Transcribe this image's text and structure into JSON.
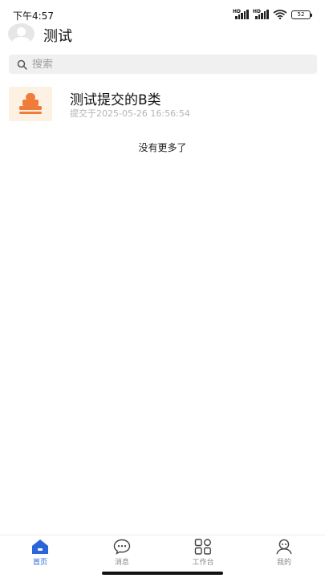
{
  "status_bar": {
    "time": "下午4:57",
    "signal1_label": "HD",
    "signal2_label": "HD",
    "battery": "52"
  },
  "header": {
    "title": "测试"
  },
  "search": {
    "placeholder": "搜索"
  },
  "list": {
    "items": [
      {
        "title": "测试提交的B类",
        "subtitle": "提交于2025-05-26 16:56:54",
        "icon": "stamp-icon"
      }
    ],
    "end_text": "没有更多了"
  },
  "tab_bar": {
    "active": "home",
    "tabs": [
      {
        "id": "home",
        "label": "首页",
        "icon": "home-icon"
      },
      {
        "id": "messages",
        "label": "消息",
        "icon": "chat-icon"
      },
      {
        "id": "workbench",
        "label": "工作台",
        "icon": "grid-icon"
      },
      {
        "id": "mine",
        "label": "我的",
        "icon": "user-icon"
      }
    ]
  },
  "colors": {
    "accent": "#2b66d9",
    "stamp": "#f07c3c",
    "thumb_bg": "#fdf1e4"
  }
}
